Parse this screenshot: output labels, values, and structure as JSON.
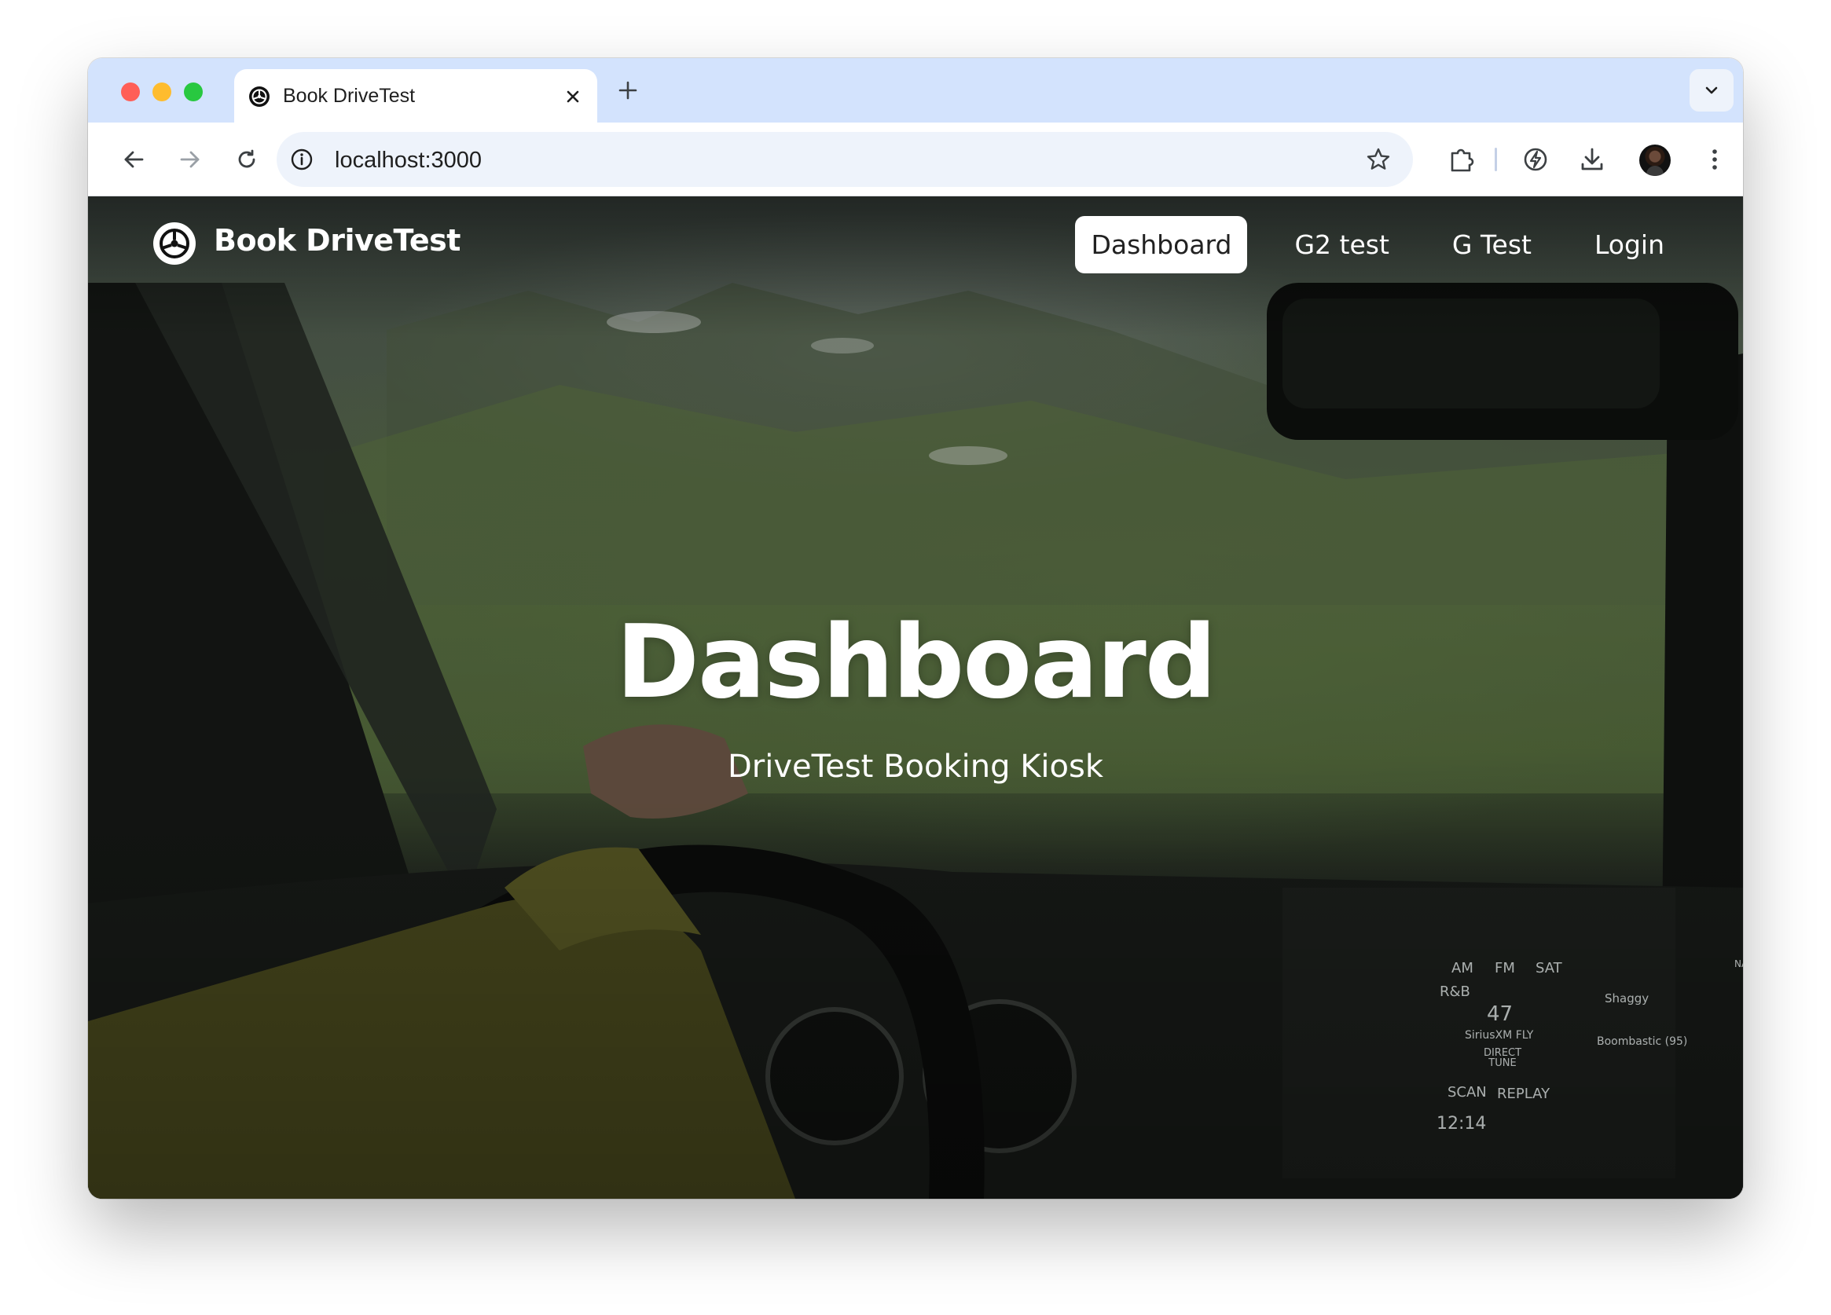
{
  "browser": {
    "tab_title": "Book DriveTest",
    "url": "localhost:3000",
    "icons": {
      "back": "arrow-left-icon",
      "forward": "arrow-right-icon",
      "reload": "reload-icon",
      "site_info": "info-icon",
      "bookmark": "star-icon",
      "extensions": "puzzle-icon",
      "performance": "lightning-icon",
      "downloads": "download-icon",
      "menu": "kebab-icon",
      "new_tab": "plus-icon",
      "close_tab": "close-icon",
      "tab_search": "chevron-down-icon"
    }
  },
  "site": {
    "brand": "Book DriveTest",
    "brand_icon": "steering-wheel-icon",
    "nav": [
      {
        "label": "Dashboard",
        "active": true
      },
      {
        "label": "G2 test",
        "active": false
      },
      {
        "label": "G Test",
        "active": false
      },
      {
        "label": "Login",
        "active": false
      }
    ]
  },
  "hero": {
    "title": "Dashboard",
    "subtitle": "DriveTest Booking Kiosk"
  },
  "car_radio": {
    "bands": [
      "AM",
      "FM",
      "SAT"
    ],
    "genre": "R&B",
    "channel": "47",
    "station": "SiriusXM FLY",
    "artist": "Shaggy",
    "song": "Boombastic (95)",
    "direct_tune": "DIRECT TUNE",
    "scan": "SCAN",
    "replay": "REPLAY",
    "clock": "12:14",
    "nav": "NAV"
  },
  "colors": {
    "tabbar": "#d3e3fd",
    "omnibox": "#eef3fb",
    "active_nav_bg": "#ffffff",
    "text_light": "#ffffff"
  }
}
